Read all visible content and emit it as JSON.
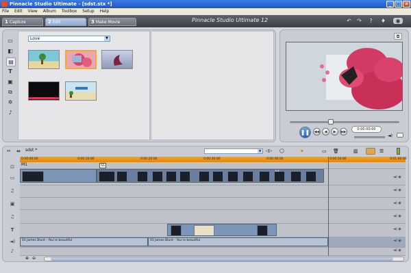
{
  "window": {
    "title": "Pinnacle Studio Ultimate - [sdst.stx *]",
    "min": "_",
    "max": "□",
    "close": "✕"
  },
  "menu": [
    "File",
    "Edit",
    "View",
    "Album",
    "Toolbox",
    "Setup",
    "Help"
  ],
  "tabs": [
    {
      "num": "1",
      "label": "Capture",
      "active": false
    },
    {
      "num": "2",
      "label": "Edit",
      "active": true
    },
    {
      "num": "3",
      "label": "Make Movie",
      "active": false
    }
  ],
  "app_title": "Pinnacle Studio Ultimate 12",
  "album": {
    "theme_value": "Love",
    "thumbnails_count": 5
  },
  "preview": {
    "timecode": "0:00:00.00"
  },
  "timeline": {
    "project_name": "sdst *",
    "ruler_labels": [
      "0:00:00:00",
      "0:00:10:00",
      "0:00:20:00",
      "0:00:30:00",
      "0:00:40:00",
      "0:00:50:00",
      "0:01:00:00"
    ],
    "clip_labels": {
      "m1": "M1",
      "s1": "S1",
      "e1": "E1"
    },
    "audio_labels": [
      "01 James Blunt - You're beautiful",
      "01 James Blunt - You're beautiful"
    ]
  },
  "colors": {
    "titlebar": "#2a63d6",
    "ruler": "#f29a18",
    "clip": "#7c95b9",
    "accent": "#3362c4"
  }
}
